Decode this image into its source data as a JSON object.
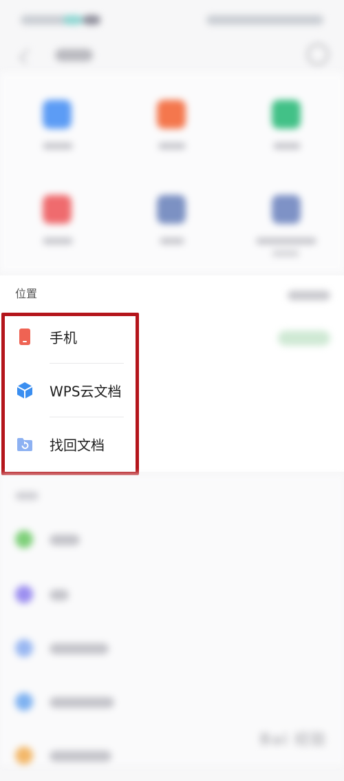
{
  "location": {
    "title": "位置",
    "items": [
      {
        "label": "手机",
        "icon": "phone-icon",
        "color": "#ef6353"
      },
      {
        "label": "WPS云文档",
        "icon": "cloud-cube-icon",
        "color": "#3a8ef0"
      },
      {
        "label": "找回文档",
        "icon": "folder-restore-icon",
        "color": "#5b8fe8"
      }
    ]
  },
  "colors": {
    "highlight_border": "#b4151b",
    "annotation_arrow": "#b4151b"
  }
}
